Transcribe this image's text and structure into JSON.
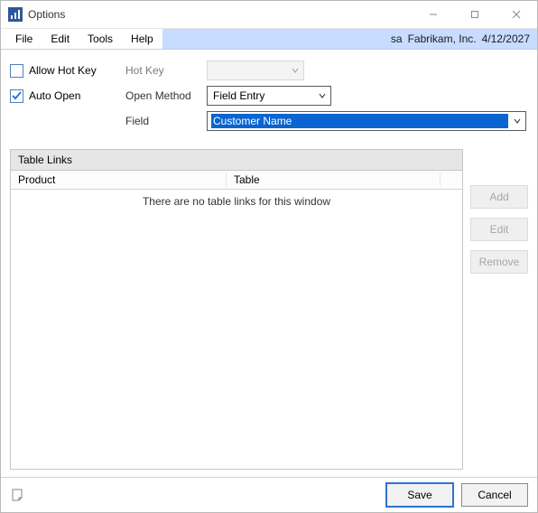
{
  "window": {
    "title": "Options"
  },
  "menus": {
    "file": "File",
    "edit": "Edit",
    "tools": "Tools",
    "help": "Help"
  },
  "status": {
    "user": "sa",
    "company": "Fabrikam, Inc.",
    "date": "4/12/2027"
  },
  "opts": {
    "allow_hot_key_label": "Allow Hot Key",
    "hot_key_label": "Hot Key",
    "hot_key_value": "",
    "auto_open_label": "Auto Open",
    "open_method_label": "Open Method",
    "open_method_value": "Field Entry",
    "field_label": "Field",
    "field_value": "Customer Name"
  },
  "table": {
    "caption": "Table Links",
    "col_product": "Product",
    "col_table": "Table",
    "empty_message": "There are no table links for this window"
  },
  "sidebar": {
    "add": "Add",
    "edit": "Edit",
    "remove": "Remove"
  },
  "footer": {
    "save": "Save",
    "cancel": "Cancel"
  }
}
